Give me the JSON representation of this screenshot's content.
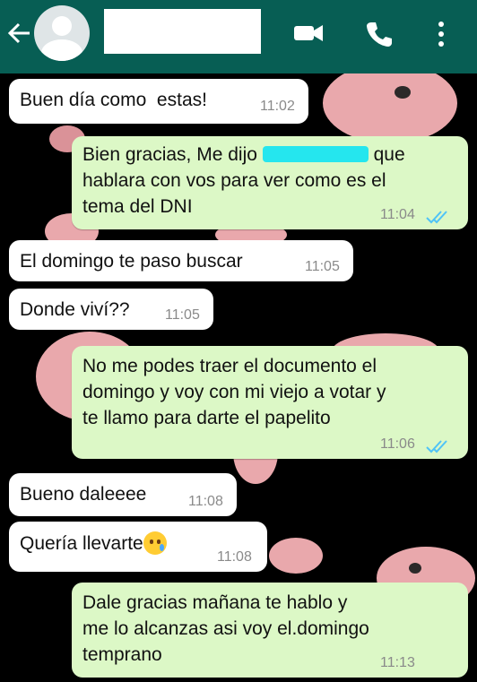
{
  "header": {
    "back_icon": "back-arrow-icon",
    "avatar_icon": "default-avatar-icon",
    "video_icon": "video-call-icon",
    "call_icon": "phone-call-icon",
    "menu_icon": "more-vert-icon",
    "colors": {
      "bar": "#075e54",
      "icon": "#ffffff"
    }
  },
  "messages": [
    {
      "dir": "in",
      "text": "Buen día como  estas!",
      "time": "11:02"
    },
    {
      "dir": "out",
      "line1_before": "Bien gracias, Me dijo ",
      "line1_after": " que",
      "line2": "hablara con vos para ver como es el",
      "line3": "tema del DNI",
      "time": "11:04",
      "status": "read"
    },
    {
      "dir": "in",
      "text": "El domingo te paso buscar",
      "time": "11:05"
    },
    {
      "dir": "in",
      "text": "Donde viví??",
      "time": "11:05"
    },
    {
      "dir": "out",
      "text": "No me podes traer el documento el\ndomingo y voy con mi viejo a votar y\nte llamo para darte el papelito",
      "time": "11:06",
      "status": "read"
    },
    {
      "dir": "in",
      "text": "Bueno daleeee",
      "time": "11:08"
    },
    {
      "dir": "in",
      "text": "Quería llevarte",
      "emoji": "sad-tear-emoji",
      "time": "11:08"
    },
    {
      "dir": "out",
      "text": "Dale gracias mañana te hablo y\nme lo alcanzas asi voy el.domingo\ntemprano",
      "time": "11:13"
    }
  ],
  "colors": {
    "incoming": "#ffffff",
    "outgoing": "#dcf8c6",
    "read_ticks": "#4fc3f7",
    "wallpaper": "#000000"
  }
}
